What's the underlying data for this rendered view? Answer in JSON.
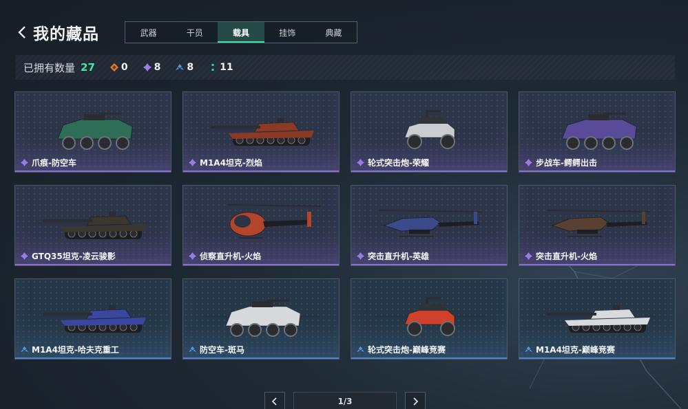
{
  "header": {
    "title": "我的藏品"
  },
  "tabs": [
    {
      "label": "武器",
      "active": false
    },
    {
      "label": "干员",
      "active": false
    },
    {
      "label": "载具",
      "active": true
    },
    {
      "label": "挂饰",
      "active": false
    },
    {
      "label": "典藏",
      "active": false
    }
  ],
  "stats": {
    "owned_label": "已拥有数量",
    "owned_count": "27",
    "rarities": [
      {
        "icon": "orange-rarity-icon",
        "color": "#e07a3a",
        "count": "0"
      },
      {
        "icon": "purple-rarity-icon",
        "color": "#9b7be6",
        "count": "8"
      },
      {
        "icon": "blue-rarity-icon",
        "color": "#4f9be0",
        "count": "8"
      },
      {
        "icon": "green-rarity-icon",
        "color": "#39d4a0",
        "count": "11"
      }
    ]
  },
  "items": [
    {
      "name": "爪痕-防空车",
      "rarity": "purple",
      "vehicle": "armored-car",
      "paint": "#2f6e56"
    },
    {
      "name": "M1A4坦克-烈焰",
      "rarity": "purple",
      "vehicle": "tank",
      "paint": "#8b3a26"
    },
    {
      "name": "轮式突击炮-荣耀",
      "rarity": "purple",
      "vehicle": "buggy",
      "paint": "#c9ccd0"
    },
    {
      "name": "步战车-鳄鳄出击",
      "rarity": "purple",
      "vehicle": "armored-car",
      "paint": "#5a4a9a"
    },
    {
      "name": "GTQ35坦克-凌云骏影",
      "rarity": "purple",
      "vehicle": "tank",
      "paint": "#3c3630"
    },
    {
      "name": "侦察直升机-火焰",
      "rarity": "purple",
      "vehicle": "scout-heli",
      "paint": "#b2452a"
    },
    {
      "name": "突击直升机-英雄",
      "rarity": "purple",
      "vehicle": "attack-heli",
      "paint": "#3b4a8a"
    },
    {
      "name": "突击直升机-火焰",
      "rarity": "purple",
      "vehicle": "attack-heli",
      "paint": "#5a4030"
    },
    {
      "name": "M1A4坦克-哈夫克重工",
      "rarity": "blue",
      "vehicle": "tank",
      "paint": "#3a46a0"
    },
    {
      "name": "防空车-斑马",
      "rarity": "blue",
      "vehicle": "armored-car",
      "paint": "#d7d9dc"
    },
    {
      "name": "轮式突击炮-巅峰竞赛",
      "rarity": "blue",
      "vehicle": "buggy",
      "paint": "#d0412c"
    },
    {
      "name": "M1A4坦克-巅峰竞赛",
      "rarity": "blue",
      "vehicle": "tank",
      "paint": "#d8dadd"
    }
  ],
  "pager": {
    "text": "1/3"
  }
}
